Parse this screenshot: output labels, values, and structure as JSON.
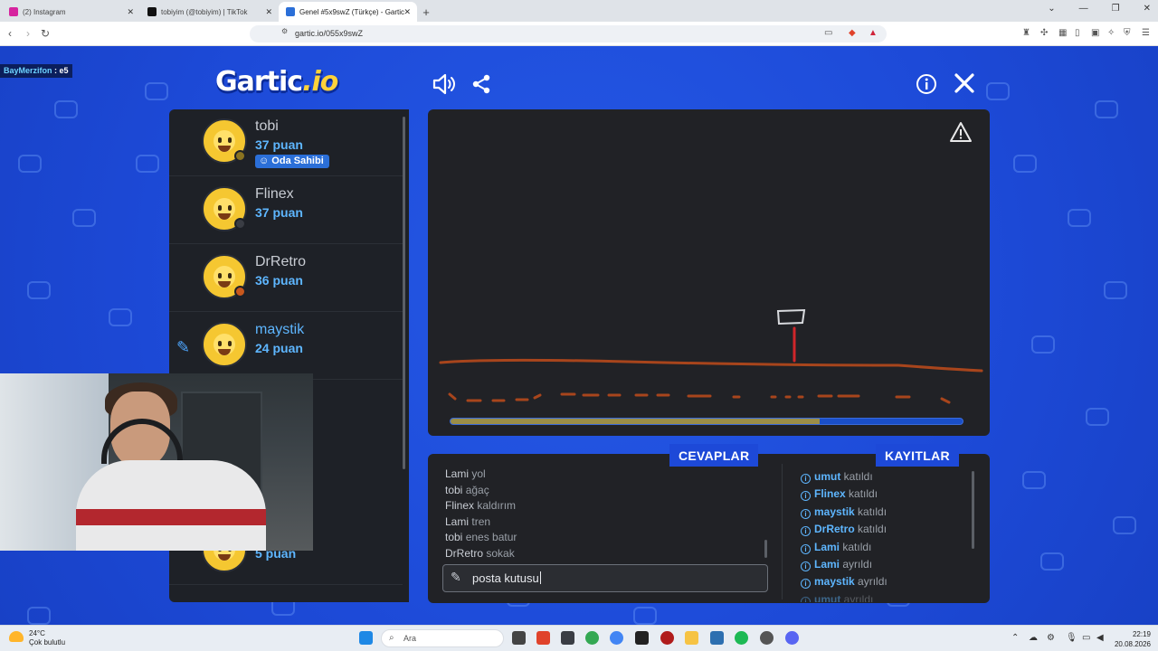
{
  "browser": {
    "tabs": [
      {
        "label": "(2) Instagram",
        "active": false,
        "color": "#d6249f"
      },
      {
        "label": "tobiyim (@tobiyim) | TikTok",
        "active": false,
        "color": "#111111"
      },
      {
        "label": "Genel #5x9swZ (Türkçe) - Gartic",
        "active": true,
        "color": "#2b6fd8"
      }
    ],
    "url": "gartic.io/055x9swZ"
  },
  "overlay": {
    "name": "BayMerzifon",
    "suffix": " : e5"
  },
  "logo": {
    "main": "Gartic",
    "suffix": ".io"
  },
  "players": [
    {
      "name": "tobi",
      "score": "37 puan",
      "badge": "Oda Sahibi",
      "status_color": "#8a7320",
      "drawing": false
    },
    {
      "name": "Flinex",
      "score": "37 puan",
      "badge": "",
      "status_color": "#3a3d44",
      "drawing": false
    },
    {
      "name": "DrRetro",
      "score": "36 puan",
      "badge": "",
      "status_color": "#c8581d",
      "drawing": false
    },
    {
      "name": "maystik",
      "score": "24 puan",
      "badge": "",
      "status_color": "",
      "drawing": true
    },
    {
      "name": "",
      "score": "5 puan",
      "badge": "",
      "status_color": "",
      "drawing": false
    }
  ],
  "canvas": {
    "timer_progress": 0.72
  },
  "answers_panel": {
    "title": "CEVAPLAR"
  },
  "logs_panel": {
    "title": "KAYITLAR"
  },
  "answers": [
    {
      "user": "Lami",
      "text": "yol"
    },
    {
      "user": "tobi",
      "text": "ağaç"
    },
    {
      "user": "Flinex",
      "text": "kaldırım"
    },
    {
      "user": "Lami",
      "text": "tren"
    },
    {
      "user": "tobi",
      "text": "enes batur"
    },
    {
      "user": "DrRetro",
      "text": "sokak"
    }
  ],
  "input": {
    "value": "posta kutusu"
  },
  "logs": [
    {
      "user": "umut",
      "text": "katıldı"
    },
    {
      "user": "Flinex",
      "text": "katıldı"
    },
    {
      "user": "maystik",
      "text": "katıldı"
    },
    {
      "user": "DrRetro",
      "text": "katıldı"
    },
    {
      "user": "Lami",
      "text": "katıldı"
    },
    {
      "user": "Lami",
      "text": "ayrıldı"
    },
    {
      "user": "maystik",
      "text": "ayrıldı"
    },
    {
      "user": "umut",
      "text": "ayrıldı"
    }
  ],
  "taskbar": {
    "weather_temp": "24°C",
    "weather_desc": "Çok bulutlu",
    "search_placeholder": "Ara",
    "time": "22:19",
    "date": "20.08.2026"
  }
}
